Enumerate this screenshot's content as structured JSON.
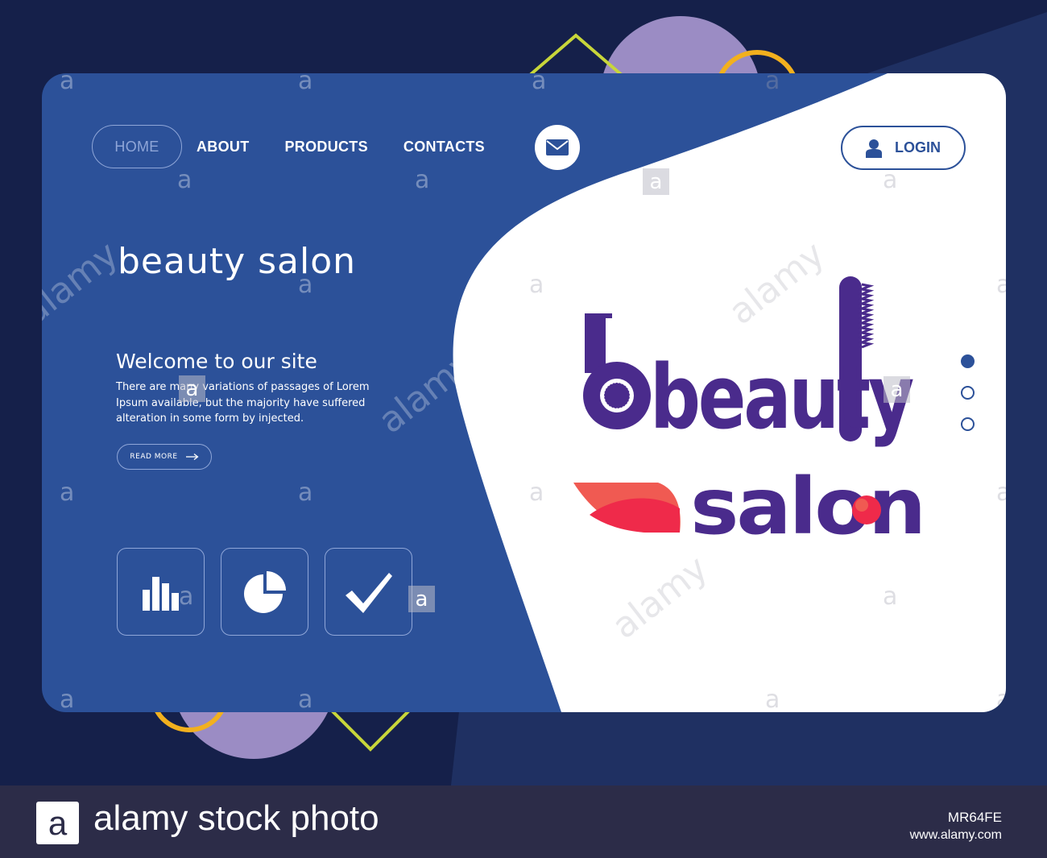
{
  "colors": {
    "page_bg": "#15204a",
    "card_blue": "#2c5199",
    "white": "#ffffff",
    "logo_purple": "#4a2b8c",
    "logo_red": "#ef2a4a",
    "logo_coral": "#f05a52",
    "deco_purple": "#9b8cc4",
    "deco_yellow": "#f2b01e",
    "deco_lime": "#c8d63a"
  },
  "nav": {
    "items": [
      {
        "label": "HOME",
        "active": true
      },
      {
        "label": "ABOUT"
      },
      {
        "label": "PRODUCTS"
      },
      {
        "label": "CONTACTS"
      }
    ],
    "mail_icon": "envelope-icon",
    "login_label": "LOGIN",
    "login_icon": "user-icon"
  },
  "hero": {
    "title": "beauty salon",
    "welcome": "Welcome to our site",
    "paragraph": "There are many variations of passages of Lorem Ipsum available, but the majority have suffered alteration in some form by injected.",
    "read_more": "READ MORE",
    "read_more_icon": "arrow-right-icon"
  },
  "features": [
    {
      "icon": "bar-chart-icon"
    },
    {
      "icon": "pie-chart-icon"
    },
    {
      "icon": "checkmark-icon"
    }
  ],
  "logo": {
    "word1": "beauty",
    "word2": "salon"
  },
  "slider": {
    "count": 3,
    "active_index": 0
  },
  "watermark": {
    "letter": "a",
    "word": "alamy"
  },
  "footer": {
    "logo_letter": "a",
    "brand": "alamy stock photo",
    "image_id": "MR64FE",
    "url": "www.alamy.com"
  }
}
